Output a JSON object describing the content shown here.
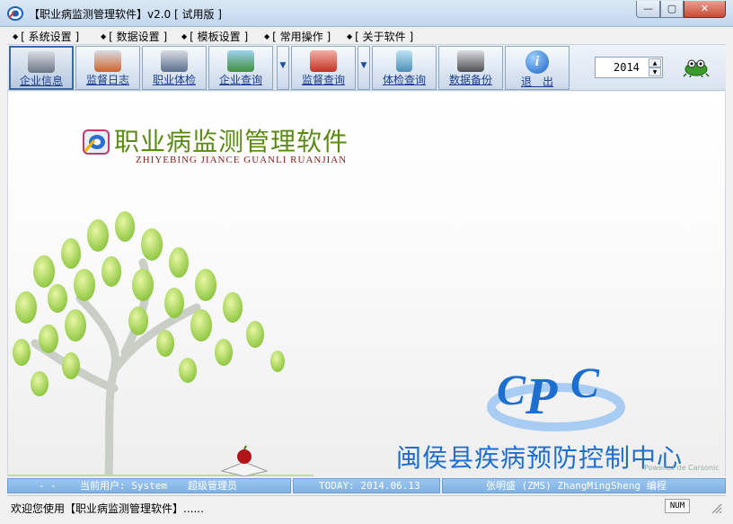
{
  "window": {
    "title": "【职业病监测管理软件】v2.0 [ 试用版 ]",
    "min_glyph": "—",
    "max_glyph": "▢",
    "close_glyph": "✕"
  },
  "menu": [
    {
      "label": "[ 系统设置 ]"
    },
    {
      "label": "[ 数据设置 ]"
    },
    {
      "label": "[ 模板设置 ]"
    },
    {
      "label": "[ 常用操作 ]"
    },
    {
      "label": "[ 关于软件 ]"
    }
  ],
  "toolbar": {
    "buttons": [
      {
        "label": "企业信息",
        "icon": "company-info-icon",
        "active": true
      },
      {
        "label": "监督日志",
        "icon": "supervision-log-icon"
      },
      {
        "label": "职业体检",
        "icon": "health-exam-icon"
      },
      {
        "label": "企业查询",
        "icon": "company-query-icon"
      },
      {
        "label": "监督查询",
        "icon": "supervision-query-icon"
      },
      {
        "label": "体检查询",
        "icon": "exam-query-icon"
      },
      {
        "label": "数据备份",
        "icon": "backup-icon"
      },
      {
        "label": "退　出",
        "icon": "info-exit-icon"
      }
    ],
    "dropdown_glyph": "▼",
    "year": "2014"
  },
  "branding": {
    "app_name": "职业病监测管理软件",
    "pinyin": "ZHIYEBING  JIANCE  GUANLI  RUANJIAN",
    "organization": "闽侯县疾病预防控制中心",
    "watermark": "Powered de Carsonic"
  },
  "infobar": {
    "dashes": "- -",
    "user_label": "当前用户: System",
    "role": "超级管理员",
    "today": "TODAY: 2014.06.13",
    "author": "张明盛 (ZMS)  ZhangMingSheng 编程"
  },
  "status": {
    "text": "欢迎您使用【职业病监测管理软件】......",
    "num": "NUM"
  },
  "colors": {
    "accent": "#1c6ed0",
    "brand_green": "#5a8a12",
    "panel_blue": "#8cbbe9"
  }
}
